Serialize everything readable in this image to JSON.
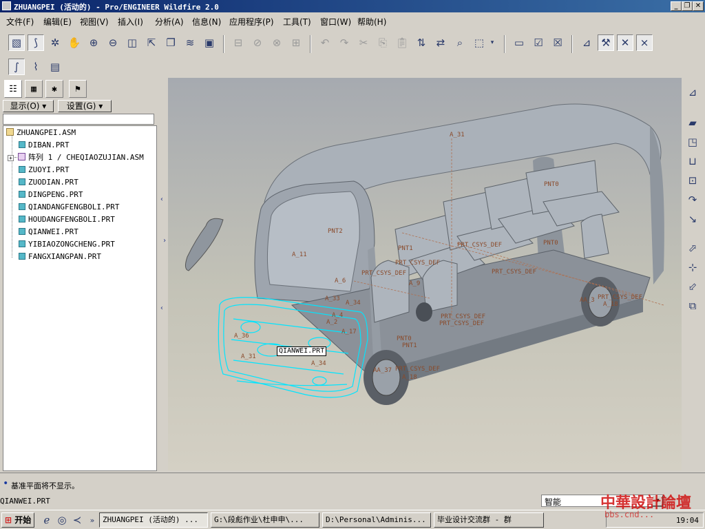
{
  "window": {
    "title": "ZHUANGPEI (活动的) - Pro/ENGINEER Wildfire 2.0",
    "controls": [
      "_",
      "❐",
      "✕"
    ]
  },
  "menu": {
    "items": [
      "文件(F)",
      "编辑(E)",
      "视图(V)",
      "插入(I)",
      "分析(A)",
      "信息(N)",
      "应用程序(P)",
      "工具(T)",
      "窗口(W)",
      "帮助(H)"
    ]
  },
  "toolbar": {
    "icons": [
      "repaint-icon",
      "orient-icon",
      "spin-icon",
      "pan-icon",
      "zoom-in-icon",
      "zoom-out-icon",
      "refit-icon",
      "reorient-icon",
      "saved-views-icon",
      "layers-icon",
      "model-display-icon",
      "datum-plane-icon",
      "datum-axis-icon",
      "datum-point-icon",
      "csys-icon",
      "undo-icon",
      "redo-icon",
      "cut-icon",
      "copy-icon",
      "paste-icon",
      "paste-special-icon",
      "regenerate-icon",
      "find-icon",
      "selection-box-icon",
      "window-activate-icon",
      "window-close-icon",
      "select-filter-icon",
      "hide-icon",
      "show-icon",
      "cross-icon"
    ]
  },
  "model_tree": {
    "show_label": "显示(O) ▾",
    "settings_label": "设置(G) ▾",
    "root": "ZHUANGPEI.ASM",
    "items": [
      "DIBAN.PRT",
      "阵列 1 / CHEQIAOZUJIAN.ASM",
      "ZUOYI.PRT",
      "ZUODIAN.PRT",
      "DINGPENG.PRT",
      "QIANDANGFENGBOLI.PRT",
      "HOUDANGFENGBOLI.PRT",
      "QIANWEI.PRT",
      "YIBIAOZONGCHENG.PRT",
      "FANGXIANGPAN.PRT"
    ]
  },
  "viewport": {
    "hover_label": "QIANWEI.PRT",
    "annotations": [
      "A_31",
      "PNT0",
      "PNT2",
      "A_11",
      "PNT1",
      "PRT_CSYS_DEF",
      "PRT_CSYS_DEF",
      "PRT_CSYS_DEF",
      "PNT0",
      "PRT_CSYS_DEF",
      "A_6",
      "A_9",
      "A_34",
      "A_33",
      "A_4",
      "A_17",
      "A_2",
      "PRT_CSYS_DEF",
      "PRT_CSYS_DEF",
      "PNT0",
      "PNT1",
      "A_31",
      "A_36",
      "A_34",
      "A_18",
      "AA_3",
      "PRT_CSYS_DEF",
      "A_18",
      "AA_37",
      "PRT_CSYS_DEF"
    ]
  },
  "message": "基准平面将不显示。",
  "status": {
    "selected": "QIANWEI.PRT",
    "filter": "智能"
  },
  "taskbar": {
    "start": "开始",
    "items": [
      "ZHUANGPEI (活动的) ...",
      "G:\\段彪作业\\杜申申\\...",
      "D:\\Personal\\Adminis...",
      "毕业设计交流群 - 群"
    ],
    "clock": "19:04"
  },
  "watermark": {
    "main": "中華設計論壇",
    "sub": "bbs.cnd..."
  },
  "colors": {
    "title_gradient_start": "#0a246a",
    "title_gradient_end": "#3a6ea5",
    "highlight": "#00e5ff",
    "annotation": "#8a4a2a",
    "model_body": "#9ea5ae"
  }
}
